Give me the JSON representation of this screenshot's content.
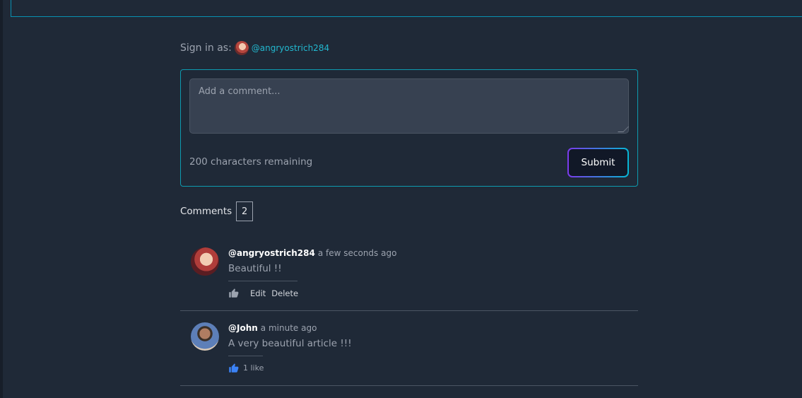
{
  "signin": {
    "label": "Sign in as:",
    "handle": "@angryostrich284"
  },
  "comment_form": {
    "placeholder": "Add a comment...",
    "remaining": "200 characters remaining",
    "submit_label": "Submit"
  },
  "comments_section": {
    "title": "Comments",
    "count": "2"
  },
  "comments": [
    {
      "author": "@angryostrich284",
      "time": "a few seconds ago",
      "text": "Beautiful !!",
      "edit_label": "Edit",
      "delete_label": "Delete",
      "liked": false
    },
    {
      "author": "@John",
      "time": "a minute ago",
      "text": "A very beautiful article !!!",
      "likes_label": "1 like",
      "liked": true
    }
  ],
  "colors": {
    "accent": "#06b6d4",
    "like_active": "#3b82f6",
    "like_inactive": "#9ca3af"
  }
}
